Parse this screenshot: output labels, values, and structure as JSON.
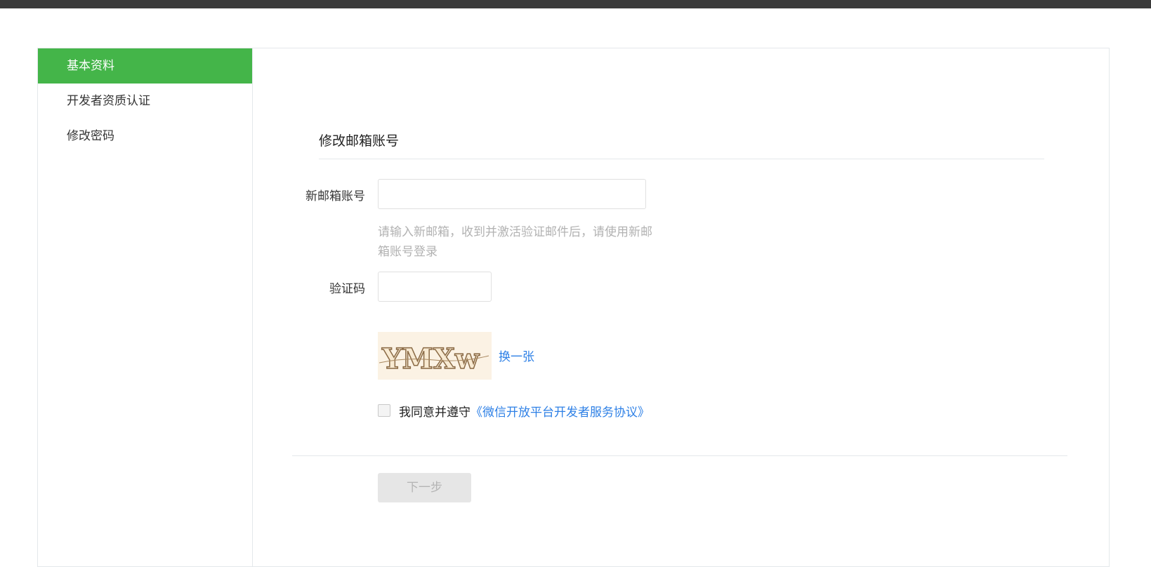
{
  "sidebar": {
    "items": [
      {
        "label": "基本资料",
        "active": true
      },
      {
        "label": "开发者资质认证",
        "active": false
      },
      {
        "label": "修改密码",
        "active": false
      }
    ]
  },
  "form": {
    "title": "修改邮箱账号",
    "email_label": "新邮箱账号",
    "email_value": "",
    "email_hint": "请输入新邮箱，收到并激活验证邮件后，请使用新邮箱账号登录",
    "captcha_label": "验证码",
    "captcha_value": "",
    "captcha_text": "YMXw",
    "swap_label": "换一张",
    "agree_text": "我同意并遵守",
    "agree_link": "《微信开放平台开发者服务协议》",
    "agree_checked": false,
    "next_label": "下一步"
  },
  "colors": {
    "accent_green": "#44b549",
    "link_blue": "#2e80e6",
    "topbar": "#3b3b3b"
  }
}
